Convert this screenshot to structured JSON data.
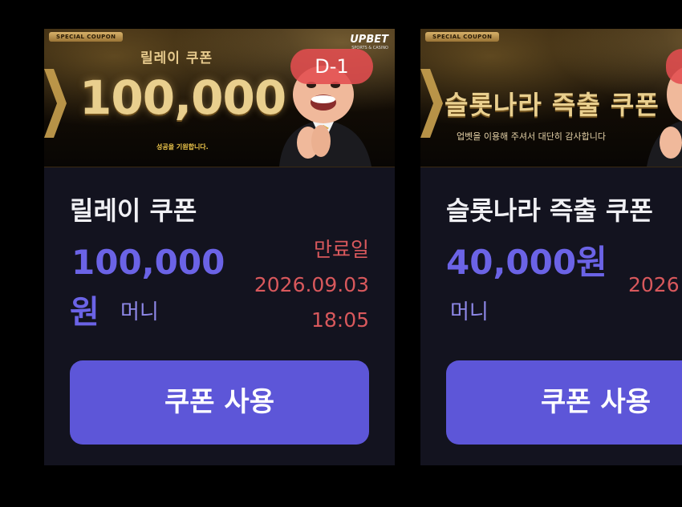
{
  "coupons": [
    {
      "banner": {
        "tag": "SPECIAL COUPON",
        "subtitle": "릴레이 쿠폰",
        "amount": "100,000",
        "small_text": "성공을 기원합니다.",
        "logo": "UPBET",
        "logo_sub": "SPORTS & CASINO"
      },
      "dday": "D-1",
      "title": "릴레이 쿠폰",
      "amount": "100,000",
      "unit": "원",
      "type": "머니",
      "expiry_label": "만료일",
      "expiry_date": "2026.09.03",
      "expiry_time": "18:05",
      "button": "쿠폰 사용"
    },
    {
      "banner": {
        "tag": "SPECIAL COUPON",
        "title": "슬롯나라 즉출 쿠폰",
        "line": "업벳을 이용해 주셔서 대단히 감사합니다"
      },
      "title": "슬롯나라 즉출 쿠폰",
      "amount": "40,000원",
      "type": "머니",
      "expiry_partial": "2026",
      "button": "쿠폰 사용"
    }
  ],
  "colors": {
    "accent": "#5d56d8",
    "amount": "#6b63e6",
    "expiry": "#d8585c",
    "dday": "#e24d50",
    "card_bg": "#13131f"
  }
}
